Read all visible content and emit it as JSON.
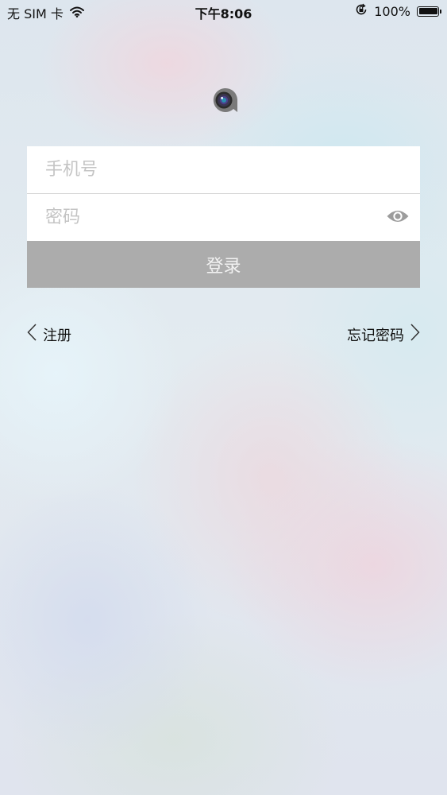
{
  "status_bar": {
    "carrier": "无 SIM 卡",
    "time": "下午8:06",
    "battery_percent_text": "100%",
    "battery_level": 1.0,
    "icons": [
      "wifi-icon",
      "orientation-lock-icon",
      "battery-icon"
    ]
  },
  "logo": {
    "icon": "camera-lens-logo"
  },
  "login": {
    "phone_placeholder": "手机号",
    "phone_value": "",
    "password_placeholder": "密码",
    "password_value": "",
    "show_password_icon": "eye-icon",
    "submit_label": "登录"
  },
  "links": {
    "register_label": "注册",
    "forgot_label": "忘记密码"
  },
  "colors": {
    "button_bg": "#acacac",
    "button_text": "#f2f2f2",
    "placeholder": "#c4c4c4",
    "field_bg": "#ffffff"
  }
}
